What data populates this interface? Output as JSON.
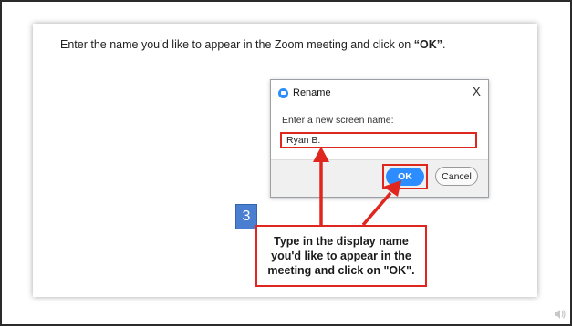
{
  "instruction": {
    "text_before": "Enter the name you’d like to appear in the Zoom meeting and click on ",
    "text_emphasis": "“OK”",
    "text_after": "."
  },
  "dialog": {
    "title": "Rename",
    "close_symbol": "X",
    "prompt_label": "Enter a new screen name:",
    "name_value": "Ryan B.",
    "ok_label": "OK",
    "cancel_label": "Cancel"
  },
  "callout": {
    "step_number": "3",
    "text": "Type in the display name you'd like to appear in the meeting and click on \"OK\"."
  },
  "colors": {
    "accent_blue": "#2d8cff",
    "highlight_red": "#e0271f",
    "step_badge": "#4a7ed0"
  },
  "icons": {
    "app_logo": "zoom-logo-icon",
    "close": "close-icon",
    "audio": "speaker-icon"
  }
}
